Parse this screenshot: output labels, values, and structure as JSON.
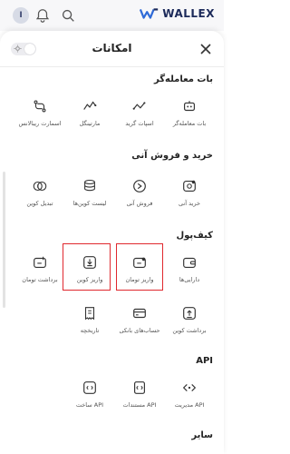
{
  "brand": {
    "name": "WALLEX"
  },
  "avatar": {
    "initial": "I"
  },
  "sheet": {
    "title": "امکانات"
  },
  "sections": [
    {
      "title": "بات معامله‌گر",
      "items": [
        {
          "label": "بات معامله‌گر",
          "icon": "bot-icon"
        },
        {
          "label": "اسپات گرید",
          "icon": "grid-icon"
        },
        {
          "label": "مارتینگل",
          "icon": "martingale-icon"
        },
        {
          "label": "اسمارت ریبالانس",
          "icon": "rebalance-icon"
        }
      ]
    },
    {
      "title": "خرید و فروش آنی",
      "items": [
        {
          "label": "خرید آنی",
          "icon": "buy-icon"
        },
        {
          "label": "فروش آنی",
          "icon": "sell-icon"
        },
        {
          "label": "لیست کوین‌ها",
          "icon": "coin-stack-icon"
        },
        {
          "label": "تبدیل کوین",
          "icon": "convert-icon"
        }
      ]
    },
    {
      "title": "کیف‌پول",
      "items": [
        {
          "label": "دارایی‌ها",
          "icon": "wallet-icon"
        },
        {
          "label": "واریز تومان",
          "icon": "deposit-toman-icon"
        },
        {
          "label": "واریز کوین",
          "icon": "deposit-coin-icon"
        },
        {
          "label": "برداشت تومان",
          "icon": "withdraw-toman-icon"
        },
        {
          "label": "برداشت کوین",
          "icon": "withdraw-coin-icon"
        },
        {
          "label": "حساب‌های بانکی",
          "icon": "bank-card-icon"
        },
        {
          "label": "تاریخچه",
          "icon": "history-icon"
        }
      ]
    },
    {
      "title": "API",
      "items": [
        {
          "label": "مدیریت API",
          "icon": "api-manage-icon"
        },
        {
          "label": "مستندات API",
          "icon": "api-docs-icon"
        },
        {
          "label": "ساخت API",
          "icon": "api-create-icon"
        }
      ]
    },
    {
      "title": "سایر",
      "items": []
    }
  ],
  "colors": {
    "brand": "#1c2a5a",
    "highlight": "#e0282e",
    "icon": "#333333"
  }
}
